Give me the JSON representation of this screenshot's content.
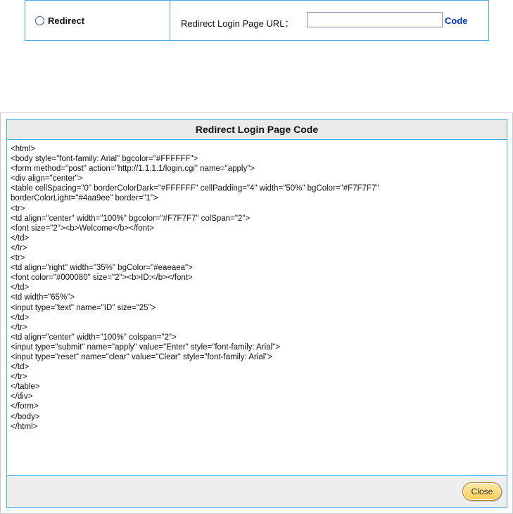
{
  "redirect_row": {
    "option_label": "Redirect",
    "url_label": "Redirect Login Page URL：",
    "url_value": "",
    "code_link": "Code"
  },
  "dialog": {
    "title": "Redirect Login Page Code",
    "code_lines": [
      "<html>",
      "<body style=\"font-family: Arial\" bgcolor=\"#FFFFFF\">",
      "<form method=\"post\" action=\"http://1.1.1.1/login.cgi\" name=\"apply\">",
      "<div align=\"center\">",
      "<table cellSpacing=\"0\" borderColorDark=\"#FFFFFF\" cellPadding=\"4\" width=\"50%\" bgColor=\"#F7F7F7\"",
      "borderColorLight=\"#4aa9ee\" border=\"1\">",
      "<tr>",
      "<td align=\"center\" width=\"100%\" bgcolor=\"#F7F7F7\" colSpan=\"2\">",
      "<font size=\"2\"><b>Welcome</b></font>",
      "</td>",
      "</tr>",
      "<tr>",
      "<td align=\"right\" width=\"35%\" bgColor=\"#eaeaea\">",
      "<font color=\"#000080\" size=\"2\"><b>ID:</b></font>",
      "</td>",
      "<td width=\"65%\">",
      "<input type=\"text\" name=\"ID\" size=\"25\">",
      "</td>",
      "</tr>",
      "<td align=\"center\" width=\"100%\" colspan=\"2\">",
      "<input type=\"submit\" name=\"apply\" value=\"Enter\" style=\"font-family: Arial\">",
      "<input type=\"reset\" name=\"clear\" value=\"Clear\" style=\"font-family: Arial\">",
      "</td>",
      "</tr>",
      "</table>",
      "</div>",
      "</form>",
      "</body>",
      "</html>"
    ],
    "close_label": "Close"
  }
}
